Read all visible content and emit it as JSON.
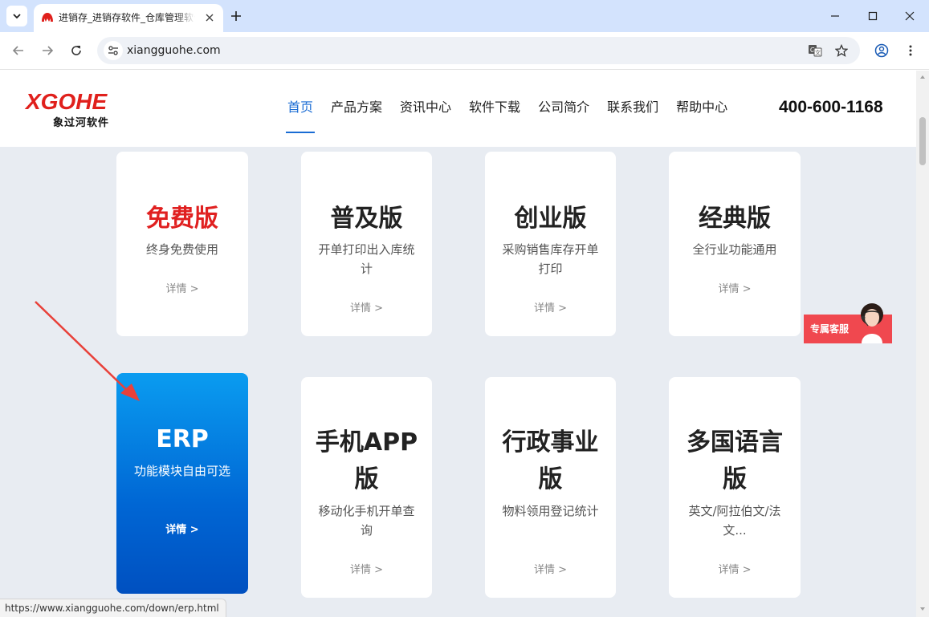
{
  "browser": {
    "tab_title": "进销存_进销存软件_仓库管理软件",
    "url": "xiangguohe.com",
    "status_url": "https://www.xiangguohe.com/down/erp.html"
  },
  "header": {
    "logo_text": "XGOHE",
    "logo_subtitle": "象过河软件",
    "nav": [
      {
        "label": "首页"
      },
      {
        "label": "产品方案"
      },
      {
        "label": "资讯中心"
      },
      {
        "label": "软件下载"
      },
      {
        "label": "公司简介"
      },
      {
        "label": "联系我们"
      },
      {
        "label": "帮助中心"
      }
    ],
    "phone": "400-600-1168"
  },
  "cards_row1": [
    {
      "title": "免费版",
      "desc": "终身免费使用",
      "link": "详情 >"
    },
    {
      "title": "普及版",
      "desc": "开单打印出入库统计",
      "link": "详情 >"
    },
    {
      "title": "创业版",
      "desc": "采购销售库存开单打印",
      "link": "详情 >"
    },
    {
      "title": "经典版",
      "desc": "全行业功能通用",
      "link": "详情 >"
    }
  ],
  "cards_row2": [
    {
      "title": "ERP",
      "desc": "功能模块自由可选",
      "link": "详情 >"
    },
    {
      "title": "手机APP版",
      "desc": "移动化手机开单查询",
      "link": "详情 >"
    },
    {
      "title": "行政事业版",
      "desc": "物料领用登记统计",
      "link": "详情 >"
    },
    {
      "title": "多国语言版",
      "desc": "英文/阿拉伯文/法文...",
      "link": "详情 >"
    }
  ],
  "service": {
    "label": "专属客服"
  },
  "colors": {
    "accent_blue": "#1a6cd4",
    "free_red": "#e02020",
    "erp_gradient_top": "#0a9cf0",
    "erp_gradient_bottom": "#0050c0",
    "service_red": "#f0484f",
    "annotation_arrow": "#e8413a"
  }
}
